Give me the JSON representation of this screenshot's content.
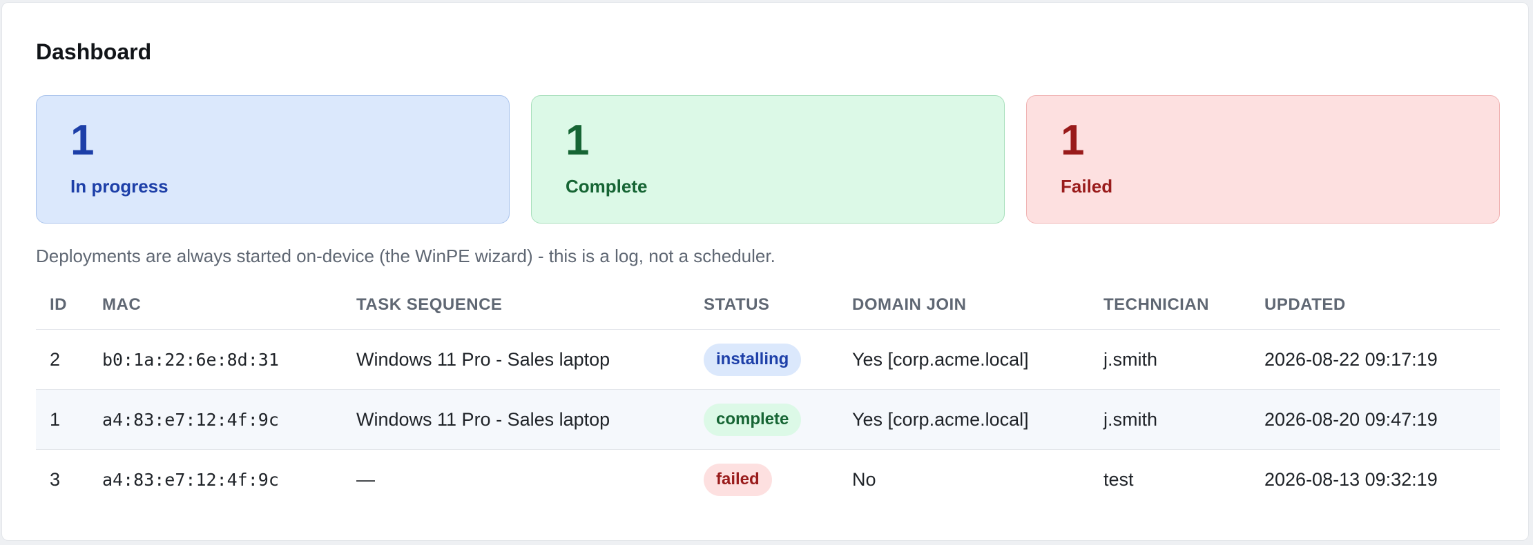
{
  "page_title": "Dashboard",
  "stats": {
    "in_progress": {
      "count": "1",
      "label": "In progress"
    },
    "complete": {
      "count": "1",
      "label": "Complete"
    },
    "failed": {
      "count": "1",
      "label": "Failed"
    }
  },
  "note": "Deployments are always started on-device (the WinPE wizard) - this is a log, not a scheduler.",
  "table": {
    "headers": [
      "ID",
      "MAC",
      "TASK SEQUENCE",
      "STATUS",
      "DOMAIN JOIN",
      "TECHNICIAN",
      "UPDATED"
    ],
    "rows": [
      {
        "id": "2",
        "mac": "b0:1a:22:6e:8d:31",
        "task_sequence": "Windows 11 Pro - Sales laptop",
        "status": "installing",
        "domain_join": "Yes [corp.acme.local]",
        "technician": "j.smith",
        "updated": "2026-08-22 09:17:19"
      },
      {
        "id": "1",
        "mac": "a4:83:e7:12:4f:9c",
        "task_sequence": "Windows 11 Pro - Sales laptop",
        "status": "complete",
        "domain_join": "Yes [corp.acme.local]",
        "technician": "j.smith",
        "updated": "2026-08-20 09:47:19"
      },
      {
        "id": "3",
        "mac": "a4:83:e7:12:4f:9c",
        "task_sequence": "—",
        "status": "failed",
        "domain_join": "No",
        "technician": "test",
        "updated": "2026-08-13 09:32:19"
      }
    ]
  },
  "colors": {
    "in_progress": "#1d3fa8",
    "complete": "#166534",
    "failed": "#991b1b"
  }
}
